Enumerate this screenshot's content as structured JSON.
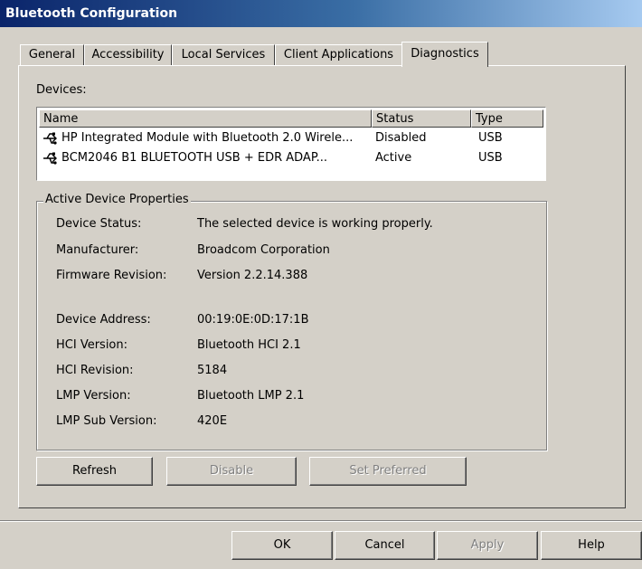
{
  "window": {
    "title": "Bluetooth Configuration"
  },
  "tabs": [
    {
      "label": "General"
    },
    {
      "label": "Accessibility"
    },
    {
      "label": "Local Services"
    },
    {
      "label": "Client Applications"
    },
    {
      "label": "Diagnostics",
      "active": true
    }
  ],
  "devices": {
    "label": "Devices:",
    "columns": [
      "Name",
      "Status",
      "Type"
    ],
    "rows": [
      {
        "name": "HP Integrated Module with Bluetooth 2.0 Wirele...",
        "status": "Disabled",
        "type": "USB",
        "icon": "usb-icon"
      },
      {
        "name": "BCM2046 B1 BLUETOOTH USB + EDR ADAP...",
        "status": "Active",
        "type": "USB",
        "icon": "usb-icon"
      }
    ]
  },
  "properties": {
    "title": "Active Device Properties",
    "items": [
      {
        "label": "Device Status:",
        "value": "The selected device is working properly."
      },
      {
        "label": "Manufacturer:",
        "value": "Broadcom Corporation"
      },
      {
        "label": "Firmware Revision:",
        "value": "Version 2.2.14.388"
      },
      {
        "label": "Device Address:",
        "value": "00:19:0E:0D:17:1B"
      },
      {
        "label": "HCI Version:",
        "value": "Bluetooth HCI 2.1"
      },
      {
        "label": "HCI Revision:",
        "value": "5184"
      },
      {
        "label": "LMP Version:",
        "value": "Bluetooth LMP 2.1"
      },
      {
        "label": "LMP Sub Version:",
        "value": "420E"
      }
    ]
  },
  "actions": {
    "refresh": "Refresh",
    "disable": "Disable",
    "set_preferred": "Set Preferred"
  },
  "dialog_buttons": {
    "ok": "OK",
    "cancel": "Cancel",
    "apply": "Apply",
    "help": "Help"
  }
}
